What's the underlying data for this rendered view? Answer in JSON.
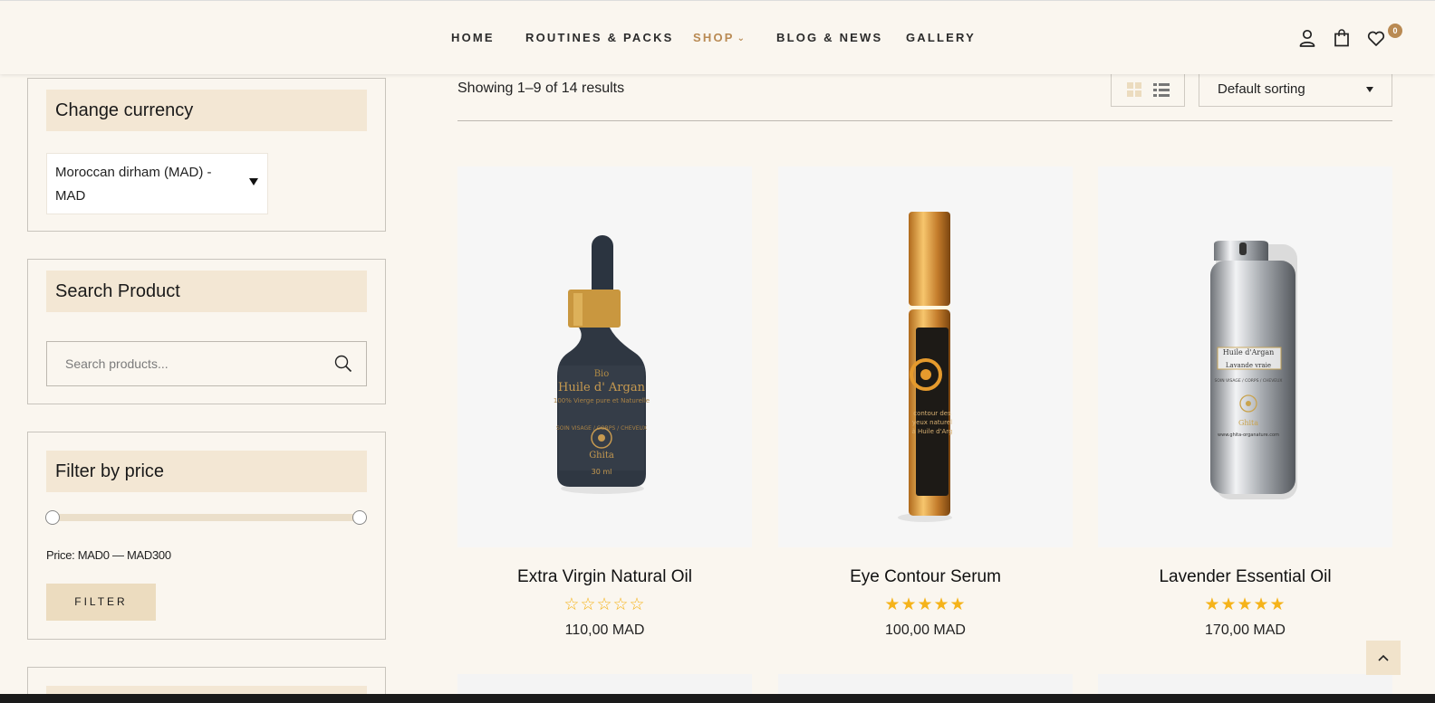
{
  "nav": {
    "items": [
      {
        "label": "HOME"
      },
      {
        "label": "ROUTINES & PACKS"
      },
      {
        "label": "SHOP"
      },
      {
        "label": "BLOG & NEWS"
      },
      {
        "label": "GALLERY"
      }
    ],
    "wishlist_count": "0",
    "icons": [
      "user-icon",
      "shopping-bag-icon",
      "heart-icon"
    ]
  },
  "sidebar": {
    "currency": {
      "title": "Change currency",
      "selected": "Moroccan dirham (MAD) - MAD"
    },
    "search": {
      "title": "Search Product",
      "placeholder": "Search products..."
    },
    "price_filter": {
      "title": "Filter by price",
      "price_label": "Price: MAD0 — MAD300",
      "min": 0,
      "max": 300,
      "button": "FILTER"
    }
  },
  "toolbar": {
    "result_count": "Showing 1–9 of 14 results",
    "sorting": "Default sorting",
    "view_modes": [
      "grid-view-icon",
      "list-view-icon"
    ]
  },
  "products": [
    {
      "name": "Extra Virgin Natural Oil",
      "price": "110,00 MAD",
      "rating": 0,
      "image": "dark-dropper-bottle"
    },
    {
      "name": "Eye Contour Serum",
      "price": "100,00 MAD",
      "rating": 5,
      "image": "gold-roller-bottle"
    },
    {
      "name": "Lavender Essential Oil",
      "price": "170,00 MAD",
      "rating": 5,
      "image": "silver-pump-bottle"
    }
  ],
  "colors": {
    "background": "#faf6ef",
    "accent": "#b98a53",
    "widget_title_bg": "#f3e7d4",
    "button_bg": "#ecdcbf",
    "star": "#f5b31a"
  }
}
